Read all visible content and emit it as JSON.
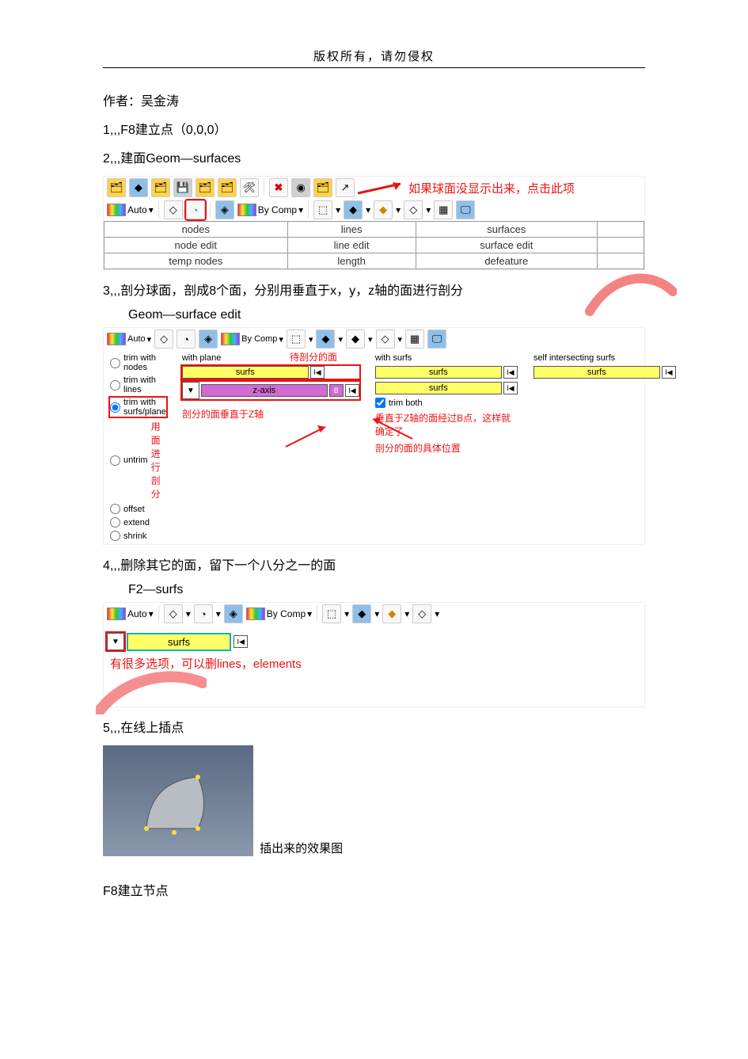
{
  "header": "版权所有，请勿侵权",
  "author_line": "作者：吴金涛",
  "step1": "1,,,F8建立点（0,0,0）",
  "step2": "2,,,建面Geom—surfaces",
  "note2_red": "如果球面没显示出来，点击此项",
  "toolbar2": {
    "auto": "Auto",
    "bycomp": "By Comp"
  },
  "table2": {
    "r1": [
      "nodes",
      "lines",
      "surfaces"
    ],
    "r2": [
      "node edit",
      "line edit",
      "surface edit"
    ],
    "r3": [
      "temp nodes",
      "length",
      "defeature"
    ]
  },
  "step3": "3,,,剖分球面，剖成8个面，分别用垂直于x，y，z轴的面进行剖分",
  "step3_sub": "Geom—surface edit",
  "panel3": {
    "auto": "Auto",
    "bycomp": "By Comp",
    "opt_trim_nodes": "trim with nodes",
    "opt_trim_lines": "trim with lines",
    "opt_trim_sp": "trim with surfs/plane",
    "opt_untrim": "untrim",
    "opt_offset": "offset",
    "opt_extend": "extend",
    "opt_shrink": "shrink",
    "hdr_withplane": "with plane",
    "hdr_withsurfs": "with surfs",
    "hdr_selfint": "self intersecting surfs",
    "btn_surfs": "surfs",
    "btn_zaxis": "z-axis",
    "btn_B": "B",
    "chk_trimboth": "trim both",
    "ann_top": "待剖分的面",
    "ann_left": "用面进行剖分",
    "ann_mid": "剖分的面垂直于Z轴",
    "ann_right1": "垂直于Z轴的面经过B点，这样就确定了",
    "ann_right2": "剖分的面的具体位置"
  },
  "step4": "4,,,删除其它的面，留下一个八分之一的面",
  "step4_sub": "F2—surfs",
  "panel4": {
    "auto": "Auto",
    "bycomp": "By Comp",
    "surfs": "surfs",
    "note": "有很多选项，可以删lines，elements"
  },
  "step5": "5,,,在线上插点",
  "effect_caption": "插出来的效果图",
  "step5b": "F8建立节点"
}
